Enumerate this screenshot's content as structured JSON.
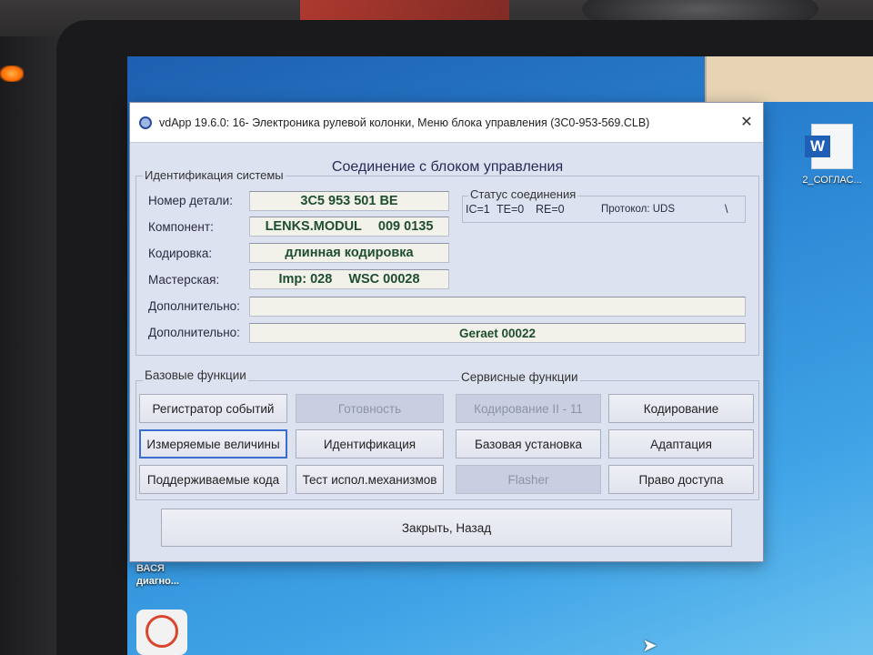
{
  "window": {
    "title": "vdApp 19.6.0: 16- Электроника рулевой колонки,  Меню блока управления (3C0-953-569.CLB)",
    "close_glyph": "✕",
    "header": "Соединение с блоком управления"
  },
  "identification": {
    "legend": "Идентификация системы",
    "rows": [
      {
        "label": "Номер детали:",
        "parts": [
          "3C5 953 501 BE"
        ]
      },
      {
        "label": "Компонент:",
        "parts": [
          "LENKS.MODUL",
          "009 0135"
        ]
      },
      {
        "label": "Кодировка:",
        "parts": [
          "длинная кодировка"
        ]
      },
      {
        "label": "Мастерская:",
        "parts": [
          "Imp: 028",
          "WSC 00028"
        ]
      },
      {
        "label": "Дополнительно:",
        "parts": [
          ""
        ]
      },
      {
        "label": "Дополнительно:",
        "parts": [
          "Geraet 00022"
        ]
      }
    ]
  },
  "connection_status": {
    "legend": "Статус соединения",
    "ic": "IC=1",
    "te": "TE=0",
    "re": "RE=0",
    "protocol": "Протокол: UDS",
    "activity": "\\"
  },
  "basic_functions": {
    "label": "Базовые функции",
    "buttons": [
      {
        "label": "Регистратор событий",
        "enabled": true
      },
      {
        "label": "Готовность",
        "enabled": false
      },
      {
        "label": "Измеряемые величины",
        "enabled": true,
        "focused": true
      },
      {
        "label": "Идентификация",
        "enabled": true
      },
      {
        "label": "Поддерживаемые кода",
        "enabled": true
      },
      {
        "label": "Тест испол.механизмов",
        "enabled": true
      }
    ]
  },
  "service_functions": {
    "label": "Сервисные функции",
    "buttons": [
      {
        "label": "Кодирование II - 11",
        "enabled": false
      },
      {
        "label": "Кодирование",
        "enabled": true
      },
      {
        "label": "Базовая установка",
        "enabled": true
      },
      {
        "label": "Адаптация",
        "enabled": true
      },
      {
        "label": "Flasher",
        "enabled": false
      },
      {
        "label": "Право доступа",
        "enabled": true
      }
    ]
  },
  "footer": {
    "close_back": "Закрыть, Назад"
  },
  "desktop": {
    "icons": [
      {
        "name": "word-document",
        "label": "2_СОГЛАС..."
      },
      {
        "name": "diagnostic-app",
        "label": "ВАСЯ диагно..."
      }
    ],
    "word_glyph": "W"
  }
}
